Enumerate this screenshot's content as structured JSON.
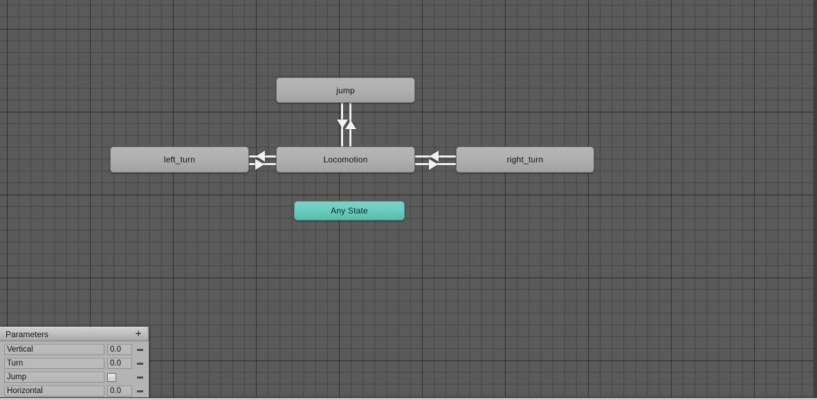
{
  "window": {
    "name": "animator-state-machine-canvas",
    "background_color": "#5a5a5a",
    "grid_major_color": "#2b2b2b",
    "grid_minor_color": "#4e4e4e"
  },
  "states": [
    {
      "id": "jump",
      "label": "jump",
      "color": "#b0b0b0",
      "type": "state"
    },
    {
      "id": "locomotion",
      "label": "Locomotion",
      "color": "#b0b0b0",
      "type": "state"
    },
    {
      "id": "left_turn",
      "label": "left_turn",
      "color": "#b0b0b0",
      "type": "state"
    },
    {
      "id": "right_turn",
      "label": "right_turn",
      "color": "#b0b0b0",
      "type": "state"
    },
    {
      "id": "any_state",
      "label": "Any State",
      "color": "#6ccec0",
      "type": "special"
    }
  ],
  "transitions": [
    {
      "from": "locomotion",
      "to": "jump",
      "direction": "up"
    },
    {
      "from": "jump",
      "to": "locomotion",
      "direction": "down"
    },
    {
      "from": "locomotion",
      "to": "left_turn",
      "direction": "left"
    },
    {
      "from": "left_turn",
      "to": "locomotion",
      "direction": "right"
    },
    {
      "from": "locomotion",
      "to": "right_turn",
      "direction": "right"
    },
    {
      "from": "right_turn",
      "to": "locomotion",
      "direction": "left"
    }
  ],
  "parameters_panel": {
    "title": "Parameters",
    "add_button_label": "+",
    "remove_button_label": "–",
    "rows": [
      {
        "name": "Vertical",
        "type": "float",
        "value": "0.0"
      },
      {
        "name": "Turn",
        "type": "float",
        "value": "0.0"
      },
      {
        "name": "Jump",
        "type": "bool",
        "value": ""
      },
      {
        "name": "Horizontal",
        "type": "float",
        "value": "0.0"
      }
    ]
  }
}
